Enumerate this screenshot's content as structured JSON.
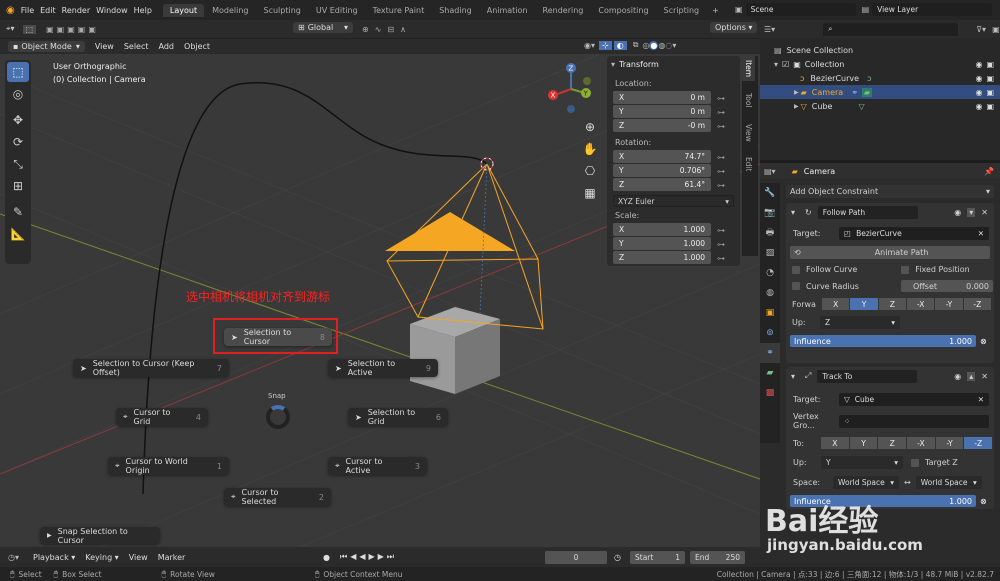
{
  "topbar": {
    "menus": [
      "File",
      "Edit",
      "Render",
      "Window",
      "Help"
    ],
    "workspaces": [
      "Layout",
      "Modeling",
      "Sculpting",
      "UV Editing",
      "Texture Paint",
      "Shading",
      "Animation",
      "Rendering",
      "Compositing",
      "Scripting"
    ],
    "scene": "Scene",
    "view_layer": "View Layer"
  },
  "header": {
    "orientation": "Global",
    "options": "Options",
    "mode": "Object Mode",
    "menus": [
      "View",
      "Select",
      "Add",
      "Object"
    ]
  },
  "viewport": {
    "view_name": "User Orthographic",
    "collection_info": "(0) Collection | Camera",
    "annotation": "选中相机将相机对齐到游标",
    "snap_label": "Snap",
    "pie": [
      {
        "label": "Selection to Cursor",
        "num": "8"
      },
      {
        "label": "Selection to Cursor (Keep Offset)",
        "num": "7"
      },
      {
        "label": "Selection to Active",
        "num": "9"
      },
      {
        "label": "Cursor to Grid",
        "num": "4"
      },
      {
        "label": "Selection to Grid",
        "num": "6"
      },
      {
        "label": "Cursor to World Origin",
        "num": "1"
      },
      {
        "label": "Cursor to Active",
        "num": "3"
      },
      {
        "label": "Cursor to Selected",
        "num": "2"
      }
    ],
    "last_op": "Snap Selection to Cursor"
  },
  "npanel": {
    "title": "Transform",
    "location_label": "Location:",
    "location": [
      [
        "X",
        "0 m"
      ],
      [
        "Y",
        "0 m"
      ],
      [
        "Z",
        "-0 m"
      ]
    ],
    "rotation_label": "Rotation:",
    "rotation": [
      [
        "X",
        "74.7°"
      ],
      [
        "Y",
        "0.706°"
      ],
      [
        "Z",
        "61.4°"
      ]
    ],
    "rotation_mode": "XYZ Euler",
    "scale_label": "Scale:",
    "scale": [
      [
        "X",
        "1.000"
      ],
      [
        "Y",
        "1.000"
      ],
      [
        "Z",
        "1.000"
      ]
    ],
    "tabs": [
      "Item",
      "Tool",
      "View",
      "Edit"
    ]
  },
  "outliner": {
    "root": "Scene Collection",
    "collection": "Collection",
    "items": [
      "BezierCurve",
      "Camera",
      "Cube"
    ]
  },
  "properties": {
    "object": "Camera",
    "add_constraint": "Add Object Constraint",
    "follow_path": {
      "name": "Follow Path",
      "target_label": "Target:",
      "target": "BezierCurve",
      "animate_path": "Animate Path",
      "follow_curve": "Follow Curve",
      "fixed_position": "Fixed Position",
      "curve_radius": "Curve Radius",
      "offset_label": "Offset",
      "offset": "0.000",
      "forward_label": "Forwa",
      "forward_axes": [
        "X",
        "Y",
        "Z",
        "-X",
        "-Y",
        "-Z"
      ],
      "up_label": "Up:",
      "up": "Z",
      "influence_label": "Influence",
      "influence": "1.000"
    },
    "track_to": {
      "name": "Track To",
      "target_label": "Target:",
      "target": "Cube",
      "vertex_group_label": "Vertex Gro...",
      "to_label": "To:",
      "to_axes": [
        "X",
        "Y",
        "Z",
        "-X",
        "-Y",
        "-Z"
      ],
      "up_label": "Up:",
      "up": "Y",
      "target_z": "Target Z",
      "space_label": "Space:",
      "space_owner": "World Space",
      "space_target": "World Space",
      "influence_label": "Influence",
      "influence": "1.000"
    }
  },
  "timeline": {
    "menus": [
      "Playback",
      "Keying",
      "View",
      "Marker"
    ],
    "frame": "0",
    "start_label": "Start",
    "start": "1",
    "end_label": "End",
    "end": "250"
  },
  "status": {
    "select": "Select",
    "box_select": "Box Select",
    "rotate_view": "Rotate View",
    "context_menu": "Object Context Menu",
    "info": "Collection | Camera | 点:33 | 边:6 | 三角面:12 | 物体:1/3 | 48.7 MiB | v2.82.7"
  },
  "watermark": {
    "brand": "Bai经验",
    "url": "jingyan.baidu.com"
  }
}
